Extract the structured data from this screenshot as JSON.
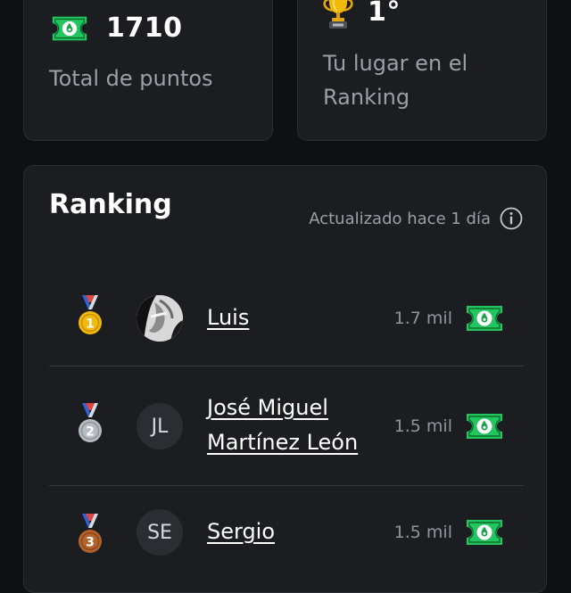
{
  "summary": {
    "points_value": "1710",
    "points_label": "Total de puntos",
    "rank_value": "1°",
    "rank_label": "Tu lugar en el Ranking"
  },
  "ranking": {
    "title": "Ranking",
    "updated": "Actualizado hace 1 día",
    "rows": [
      {
        "position": 1,
        "name": "Luis",
        "initials": "",
        "points": "1.7 mil"
      },
      {
        "position": 2,
        "name": "José Miguel Martínez León",
        "initials": "JL",
        "points": "1.5 mil"
      },
      {
        "position": 3,
        "name": "Sergio",
        "initials": "SE",
        "points": "1.5 mil"
      }
    ]
  },
  "colors": {
    "background": "#0f1012",
    "card": "#1b1d20",
    "ticket": "#22c55e",
    "gold": "#f0b90b",
    "silver": "#b7bcc2",
    "bronze": "#b4632c"
  },
  "icons": {
    "points": "ticket-icon",
    "rank": "trophy-icon",
    "info": "info-icon",
    "medals": [
      "gold-medal-icon",
      "silver-medal-icon",
      "bronze-medal-icon"
    ]
  }
}
